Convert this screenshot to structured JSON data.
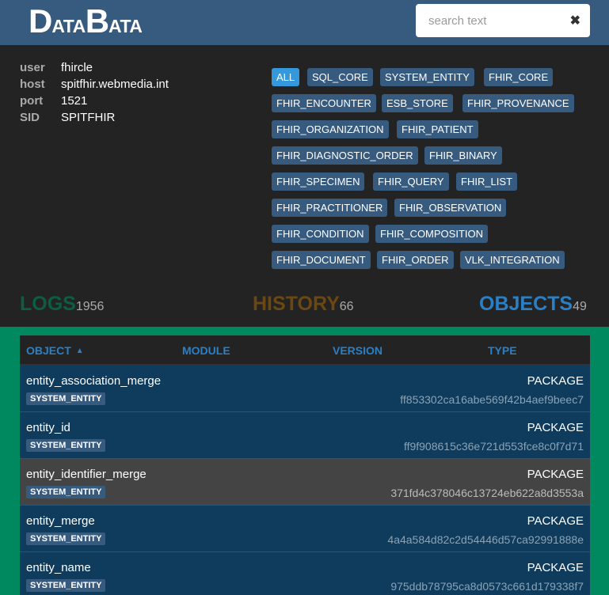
{
  "header": {
    "logo": {
      "d": "D",
      "ata1": "ATA",
      "b": "B",
      "ata2": "ATA"
    },
    "search": {
      "placeholder": "search text",
      "clear_icon": "close-icon"
    }
  },
  "connection": [
    {
      "key": "user",
      "value": "fhircle"
    },
    {
      "key": "host",
      "value": "spitfhir.webmedia.int"
    },
    {
      "key": "port",
      "value": "1521"
    },
    {
      "key": "SID",
      "value": "SPITFHIR"
    }
  ],
  "tags": [
    "ALL",
    "SQL_CORE",
    "SYSTEM_ENTITY",
    "FHIR_CORE",
    "FHIR_ENCOUNTER",
    "ESB_STORE",
    "FHIR_PROVENANCE",
    "FHIR_ORGANIZATION",
    "FHIR_PATIENT",
    "FHIR_DIAGNOSTIC_ORDER",
    "FHIR_BINARY",
    "FHIR_SPECIMEN",
    "FHIR_QUERY",
    "FHIR_LIST",
    "FHIR_PRACTITIONER",
    "FHIR_OBSERVATION",
    "FHIR_CONDITION",
    "FHIR_COMPOSITION",
    "FHIR_DOCUMENT",
    "FHIR_ORDER",
    "VLK_INTEGRATION"
  ],
  "active_tag": "ALL",
  "counters": {
    "logs": {
      "label": "LOGS",
      "count": "1956"
    },
    "history": {
      "label": "HISTORY",
      "count": "66"
    },
    "objects": {
      "label": "OBJECTS",
      "count": "49"
    }
  },
  "colors": {
    "accent": "#375a7f",
    "active_tag": "#3498db",
    "green": "#00895f",
    "logs": "#0b5e44",
    "history": "#6b4711",
    "objects": "#2a80c6"
  },
  "table": {
    "columns": {
      "object": "OBJECT",
      "module": "MODULE",
      "version": "VERSION",
      "type": "TYPE"
    },
    "sort_icon": "sort-asc-icon",
    "rows": [
      {
        "name": "entity_association_merge",
        "module": "SYSTEM_ENTITY",
        "type": "PACKAGE",
        "hash": "ff853302ca16abe569f42b4aef9beec7",
        "selected": false
      },
      {
        "name": "entity_id",
        "module": "SYSTEM_ENTITY",
        "type": "PACKAGE",
        "hash": "ff9f908615c36e721d553fce8c0f7d71",
        "selected": false
      },
      {
        "name": "entity_identifier_merge",
        "module": "SYSTEM_ENTITY",
        "type": "PACKAGE",
        "hash": "371fd4c378046c13724eb622a8d3553a",
        "selected": true
      },
      {
        "name": "entity_merge",
        "module": "SYSTEM_ENTITY",
        "type": "PACKAGE",
        "hash": "4a4a584d82c2d54446d57ca92991888e",
        "selected": false
      },
      {
        "name": "entity_name",
        "module": "SYSTEM_ENTITY",
        "type": "PACKAGE",
        "hash": "975ddb78795ca8d0573c661d179338f7",
        "selected": false
      }
    ]
  }
}
